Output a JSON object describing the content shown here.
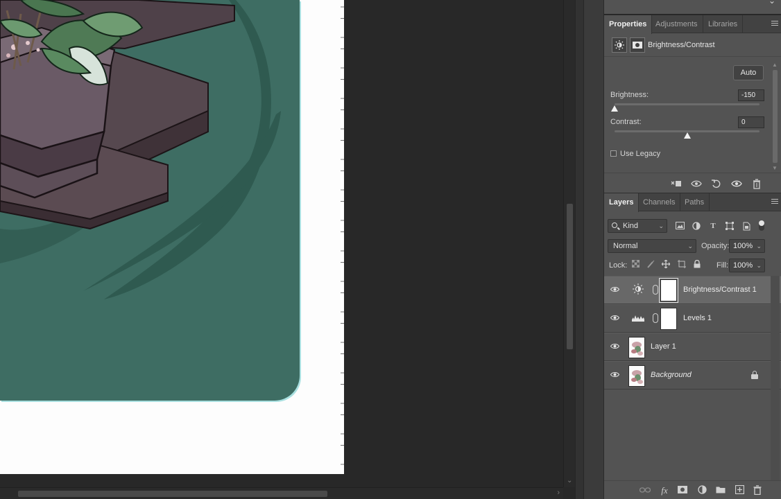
{
  "properties_panel": {
    "tabs": [
      {
        "label": "Properties",
        "active": true
      },
      {
        "label": "Adjustments",
        "active": false
      },
      {
        "label": "Libraries",
        "active": false
      }
    ],
    "adjustment_title": "Brightness/Contrast",
    "auto_label": "Auto",
    "brightness": {
      "label": "Brightness:",
      "value": "-150",
      "slider_fraction": 0.0
    },
    "contrast": {
      "label": "Contrast:",
      "value": "0",
      "slider_fraction": 0.5
    },
    "use_legacy": {
      "label": "Use Legacy",
      "checked": false
    },
    "footer_icons": [
      "clip-to-layer-icon",
      "view-previous-state-icon",
      "reset-icon",
      "toggle-visibility-icon",
      "delete-icon"
    ]
  },
  "layers_panel": {
    "tabs": [
      {
        "label": "Layers",
        "active": true
      },
      {
        "label": "Channels",
        "active": false
      },
      {
        "label": "Paths",
        "active": false
      }
    ],
    "filter_kind": "Kind",
    "blend_mode": "Normal",
    "opacity_label": "Opacity:",
    "opacity": "100%",
    "lock_label": "Lock:",
    "fill_label": "Fill:",
    "fill": "100%",
    "layers": [
      {
        "name": "Brightness/Contrast 1",
        "type": "adjustment",
        "icon": "brightness-contrast-icon",
        "visible": true,
        "selected": true
      },
      {
        "name": "Levels 1",
        "type": "adjustment",
        "icon": "levels-icon",
        "visible": true,
        "selected": false
      },
      {
        "name": "Layer 1",
        "type": "pixel",
        "visible": true,
        "selected": false
      },
      {
        "name": "Background",
        "type": "background",
        "visible": true,
        "selected": false,
        "locked": true
      }
    ],
    "footer_icons": [
      "link-layers-icon",
      "fx-icon",
      "add-mask-icon",
      "new-adjustment-icon",
      "new-group-icon",
      "new-layer-icon",
      "delete-layer-icon"
    ]
  },
  "colors": {
    "panel_bg": "#535353",
    "workspace_bg": "#282828",
    "selected_row": "#686868",
    "artwork_green": "#3e6d63"
  }
}
